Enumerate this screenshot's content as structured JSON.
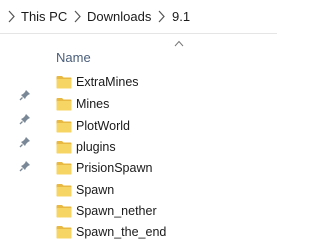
{
  "breadcrumb": {
    "items": [
      "This PC",
      "Downloads",
      "9.1"
    ]
  },
  "columns": {
    "name_header": "Name"
  },
  "icons": {
    "chevron": "chevron-right-icon",
    "folder": "folder-icon",
    "pin": "pin-icon",
    "sort": "sort-ascending-icon"
  },
  "colors": {
    "folder_body": "#F7D565",
    "folder_tab": "#E8B943",
    "header_text": "#4a5e7a"
  },
  "files": [
    {
      "name": "ExtraMines"
    },
    {
      "name": "Mines"
    },
    {
      "name": "PlotWorld"
    },
    {
      "name": "plugins"
    },
    {
      "name": "PrisionSpawn"
    },
    {
      "name": "Spawn"
    },
    {
      "name": "Spawn_nether"
    },
    {
      "name": "Spawn_the_end"
    }
  ]
}
